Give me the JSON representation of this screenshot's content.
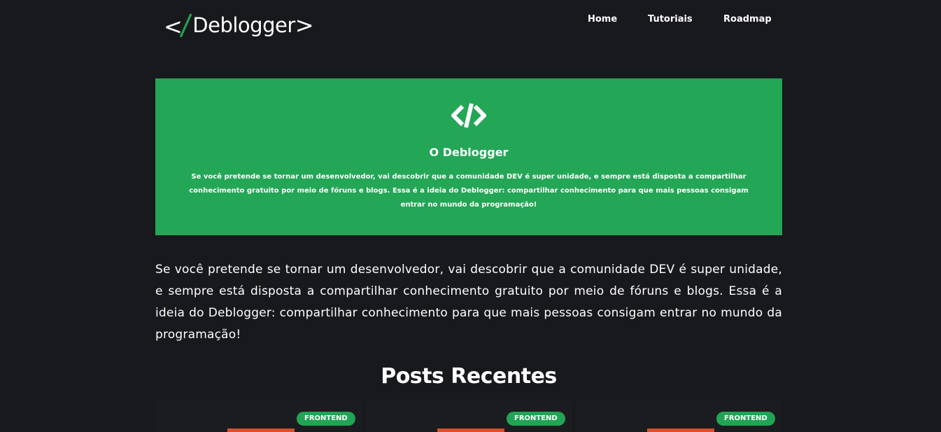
{
  "header": {
    "logo": {
      "left": "</",
      "slash": "/",
      "word": "Deblogger",
      "right": ">"
    },
    "nav": [
      {
        "label": "Home"
      },
      {
        "label": "Tutoriais"
      },
      {
        "label": "Roadmap"
      }
    ]
  },
  "hero": {
    "icon": "code-brackets-icon",
    "title": "O Deblogger",
    "text": "Se você pretende se tornar um desenvolvedor, vai descobrir que a comunidade DEV é super unidade, e sempre está disposta a compartilhar conhecimento gratuito por meio de fóruns e blogs. Essa é a ideia do Deblogger: compartilhar conhecimento para que mais pessoas consigam entrar no mundo da programação!",
    "background": "#23a656"
  },
  "intro": {
    "text": "Se você pretende se tornar um desenvolvedor, vai descobrir que a comunidade DEV é super unidade, e sempre está disposta a compartilhar conhecimento gratuito por meio de fóruns e blogs. Essa é a ideia do Deblogger: compartilhar conhecimento para que mais pessoas consigam entrar no mundo da programação!"
  },
  "posts": {
    "title": "Posts Recentes",
    "cards": [
      {
        "tag": "FRONTEND"
      },
      {
        "tag": "FRONTEND"
      },
      {
        "tag": "FRONTEND"
      }
    ]
  },
  "colors": {
    "background": "#18191c",
    "accent": "#22a455",
    "thumb": "#d9512c"
  }
}
